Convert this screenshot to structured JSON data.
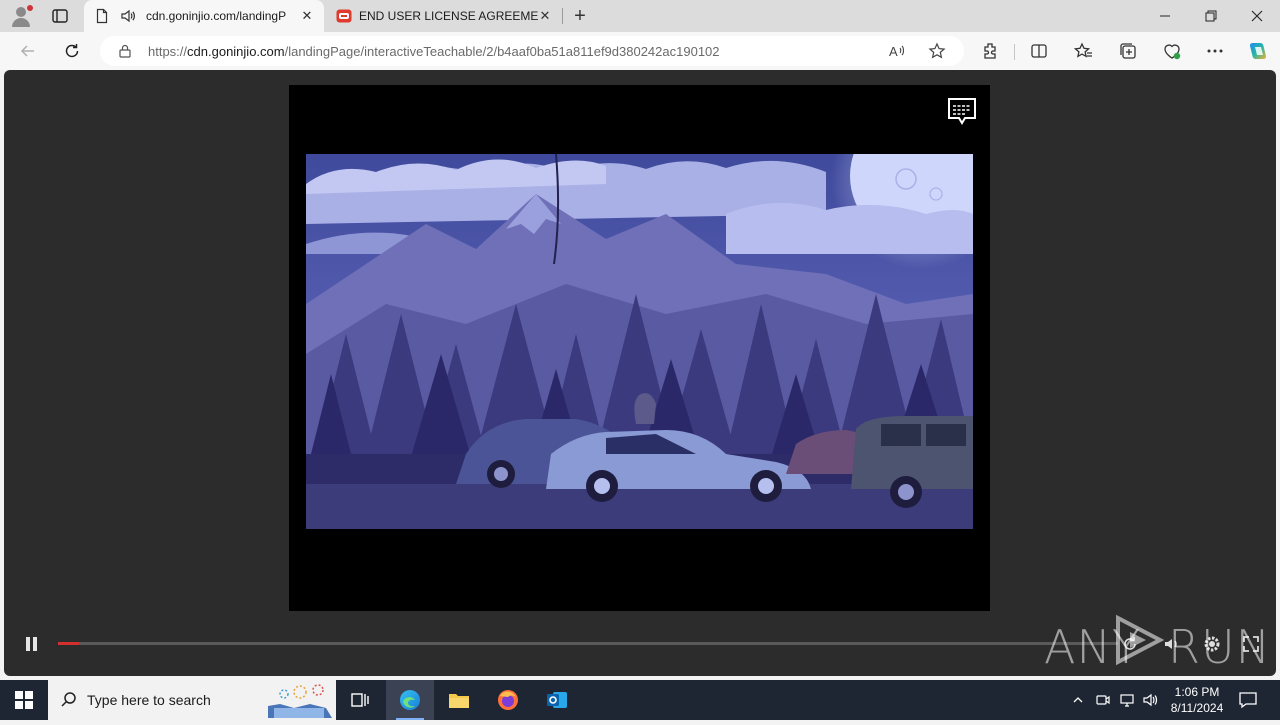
{
  "browser": {
    "tabs": [
      {
        "title": "cdn.goninjio.com/landingP",
        "active": true,
        "audio": true
      },
      {
        "title": "END USER LICENSE AGREEMENT",
        "active": false
      }
    ],
    "new_tab_icon": "plus-icon",
    "address": {
      "url_prefix": "https://",
      "url_host": "cdn.goninjio.com",
      "url_path": "/landingPage/interactiveTeachable/2/b4aaf0ba51a811ef9d380242ac190102"
    }
  },
  "player": {
    "progress": 0.0,
    "state": "playing",
    "accent_color": "#d32f2f"
  },
  "watermark": {
    "left": "ANY",
    "right": "RUN"
  },
  "taskbar": {
    "search_placeholder": "Type here to search",
    "apps": [
      "task-view",
      "edge",
      "file-explorer",
      "firefox",
      "outlook"
    ],
    "active_app": "edge",
    "time": "1:06 PM",
    "date": "8/11/2024"
  }
}
